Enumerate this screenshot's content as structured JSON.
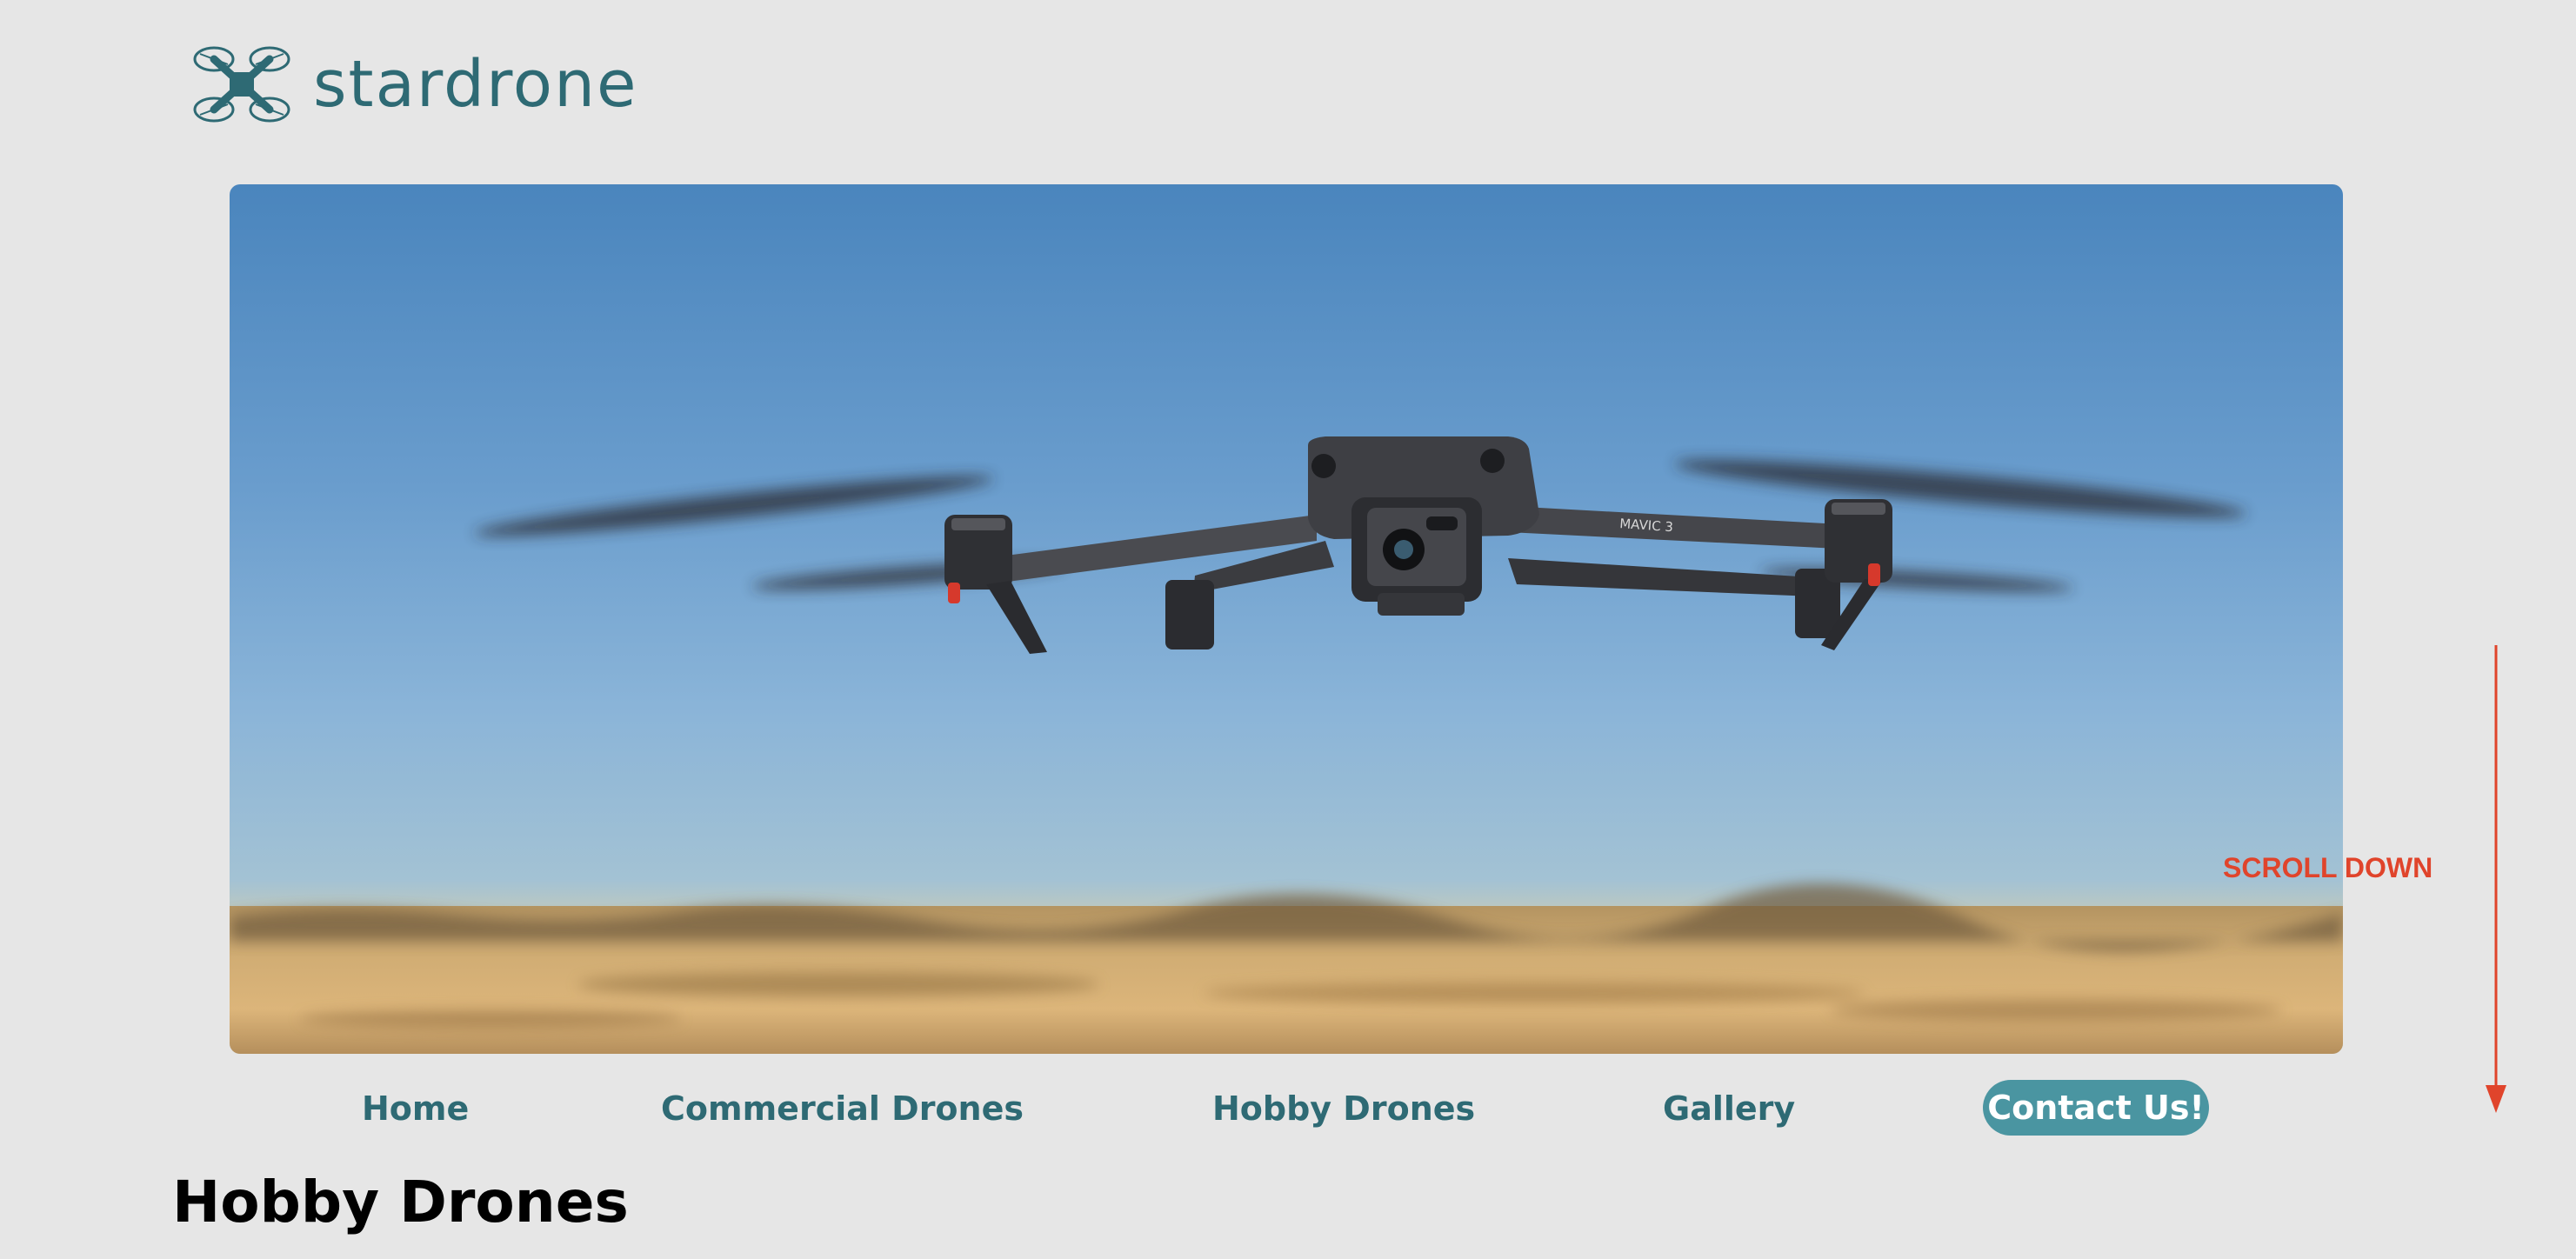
{
  "header": {
    "brand_name": "stardrone",
    "logo_icon": "drone-logo-icon"
  },
  "hero": {
    "image_subject": "drone-photo",
    "drone_model_label": "MAVIC 3"
  },
  "nav": {
    "items": [
      {
        "label": "Home"
      },
      {
        "label": "Commercial Drones"
      },
      {
        "label": "Hobby Drones"
      },
      {
        "label": "Gallery"
      }
    ],
    "contact_label": "Contact Us!"
  },
  "main": {
    "title": "Hobby Drones"
  },
  "scroll_hint": {
    "label": "SCROLL DOWN",
    "icon": "arrow-down-icon"
  },
  "colors": {
    "brand": "#2e6a74",
    "contact_button": "#4a95a1",
    "scroll_hint": "#e0442b",
    "background": "#e6e6e6"
  }
}
